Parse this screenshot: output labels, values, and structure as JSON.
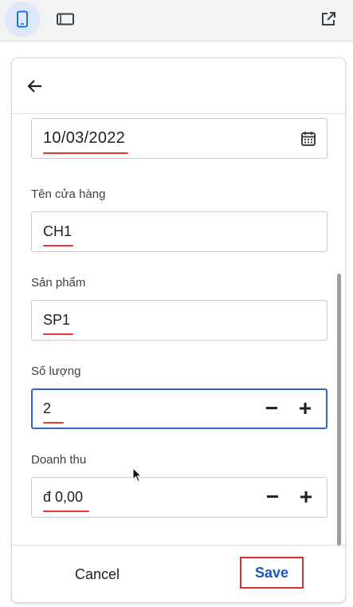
{
  "toolbar": {
    "phone_icon": "phone-view-icon",
    "tablet_icon": "tablet-view-icon",
    "open_icon": "open-in-new-icon"
  },
  "form": {
    "date": {
      "value": "10/03/2022",
      "icon": "calendar-icon"
    },
    "store": {
      "label": "Tên cửa hàng",
      "value": "CH1"
    },
    "product": {
      "label": "Sản phẩm",
      "value": "SP1"
    },
    "quantity": {
      "label": "Số lượng",
      "value": "2",
      "minus": "−",
      "plus": "+"
    },
    "revenue": {
      "label": "Doanh thu",
      "value": "đ 0,00",
      "minus": "−",
      "plus": "+"
    }
  },
  "footer": {
    "cancel_label": "Cancel",
    "save_label": "Save"
  },
  "colors": {
    "accent": "#2b66d3",
    "save_text": "#1a56c8",
    "annotation_red": "#e53935"
  }
}
